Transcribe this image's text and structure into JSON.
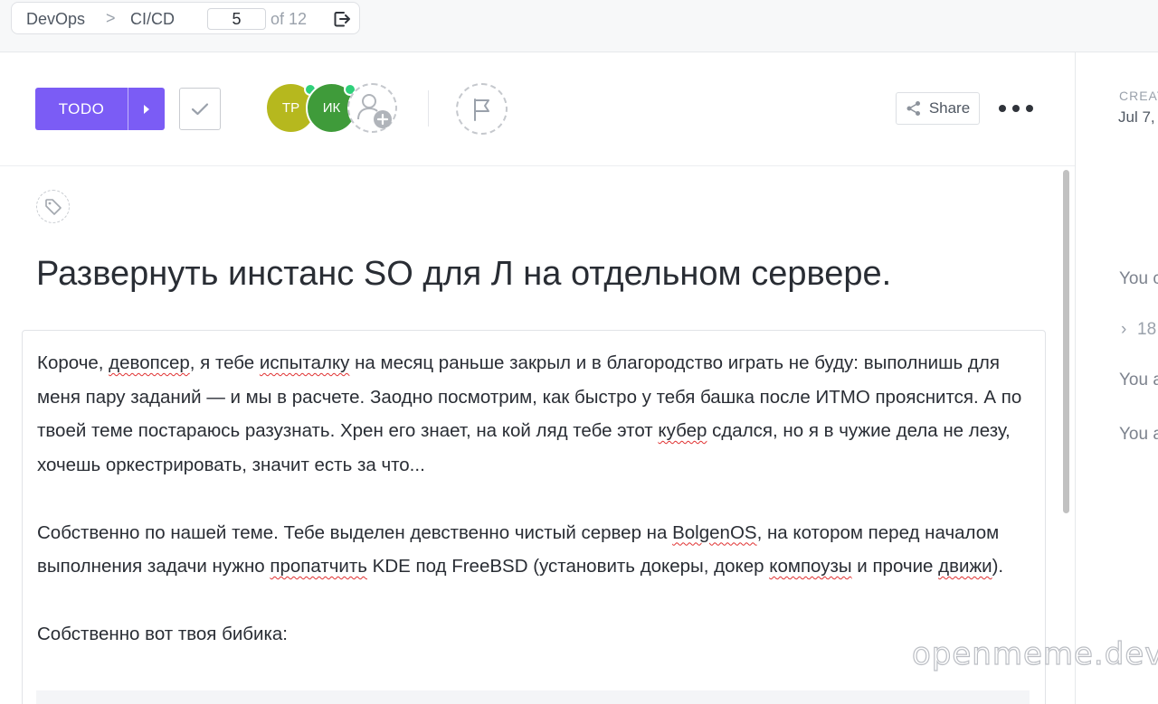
{
  "breadcrumb": {
    "items": [
      "DevOps",
      "CI/CD"
    ],
    "separator": ">",
    "page_current": "5",
    "page_total_label": "of 12"
  },
  "toolbar": {
    "status_label": "TODO",
    "status_color": "#7b5cf5",
    "assignees": [
      {
        "initials": "ТР",
        "color": "#b6b81e",
        "online": true
      },
      {
        "initials": "ИК",
        "color": "#3f9b3a",
        "online": true
      }
    ],
    "share_label": "Share"
  },
  "task": {
    "title": "Развернуть инстанс SO для Л на отдельном сервере.",
    "description": {
      "p1": [
        {
          "t": "Короче, "
        },
        {
          "t": "девопсер",
          "spell": true
        },
        {
          "t": ", я тебе "
        },
        {
          "t": "испыталку",
          "spell": true
        },
        {
          "t": " на месяц раньше закрыл и в благородство играть не буду: выполнишь для меня пару заданий — и мы в расчете. Заодно посмотрим, как быстро у тебя башка после ИТМО прояснится. А по твоей теме постараюсь разузнать. Хрен его знает, на кой ляд тебе этот "
        },
        {
          "t": "кубер",
          "spell": true
        },
        {
          "t": " сдался, но я в чужие дела не лезу, хочешь оркестрировать, значит есть за что..."
        }
      ],
      "p2": [
        {
          "t": "Собственно по нашей теме. Тебе выделен девственно чистый сервер на "
        },
        {
          "t": "BolgenOS",
          "spell": true
        },
        {
          "t": ", на котором перед началом выполнения задачи нужно "
        },
        {
          "t": "пропатчить",
          "spell": true
        },
        {
          "t": " KDE под FreeBSD (установить докеры, докер "
        },
        {
          "t": "компоузы",
          "spell": true
        },
        {
          "t": " и прочие "
        },
        {
          "t": "движи",
          "spell": true
        },
        {
          "t": ")."
        }
      ],
      "p3": "Собственно вот твоя бибика:"
    }
  },
  "right_pane": {
    "created_label": "CREAT",
    "created_date": "Jul 7,",
    "activity": [
      "You c",
      "18",
      "You a",
      "You a"
    ]
  },
  "watermark": "openmeme.dev"
}
